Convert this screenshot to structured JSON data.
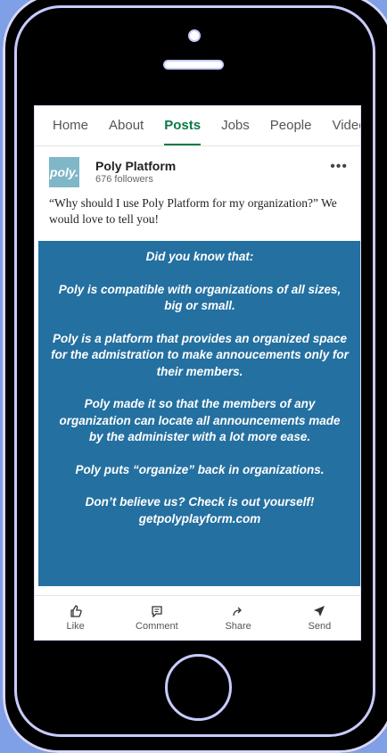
{
  "tabs": [
    {
      "label": "Home"
    },
    {
      "label": "About"
    },
    {
      "label": "Posts",
      "active": true
    },
    {
      "label": "Jobs"
    },
    {
      "label": "People"
    },
    {
      "label": "Video"
    }
  ],
  "post": {
    "logo_text": "poly.",
    "org_name": "Poly Platform",
    "followers": "676 followers",
    "caption": "“Why should I use Poly Platform for my organization?” We would love to tell you!"
  },
  "promo": {
    "p1": "Did you know that:",
    "p2": "Poly is compatible with organizations of all sizes, big or small.",
    "p3": "Poly is a platform that provides an organized space for the admistration to make annoucements only for their members.",
    "p4": "Poly made it so that the  members of any organization can locate all announcements made by the administer with a lot more ease.",
    "p5": "Poly puts “organize” back in organizations.",
    "p6": "Don’t believe us? Check is out yourself!",
    "p7": "getpolyplayform.com"
  },
  "actions": [
    {
      "label": "Like",
      "icon": "thumbs-up-icon"
    },
    {
      "label": "Comment",
      "icon": "comment-icon"
    },
    {
      "label": "Share",
      "icon": "share-icon"
    },
    {
      "label": "Send",
      "icon": "send-icon"
    }
  ],
  "colors": {
    "background": "#7f9fe6",
    "accent": "#0a7a43",
    "promo": "#2470a0"
  }
}
